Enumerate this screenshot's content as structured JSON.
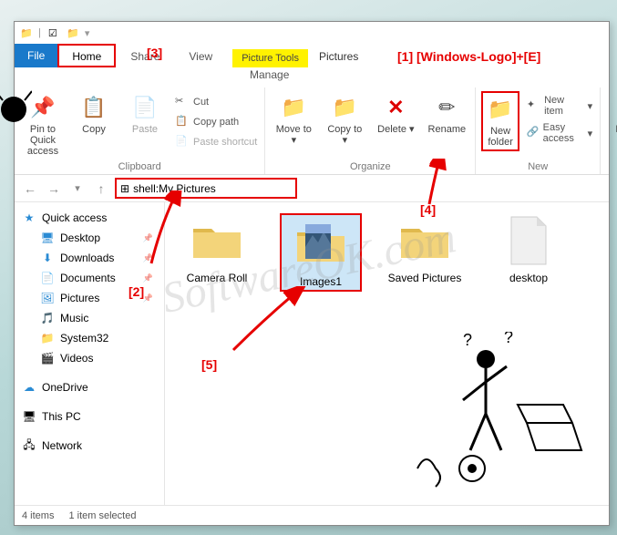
{
  "annotations": {
    "a1": "[1]  [Windows-Logo]+[E]",
    "a2": "[2]",
    "a3": "[3]",
    "a4": "[4]",
    "a5": "[5]"
  },
  "tabs": {
    "file": "File",
    "home": "Home",
    "share": "Share",
    "view": "View",
    "context_tool": "Picture Tools",
    "manage": "Manage",
    "context_label": "Pictures"
  },
  "ribbon": {
    "pin": "Pin to Quick access",
    "copy": "Copy",
    "paste": "Paste",
    "cut": "Cut",
    "copypath": "Copy path",
    "pasteshort": "Paste shortcut",
    "group_clipboard": "Clipboard",
    "moveto": "Move to",
    "copyto": "Copy to",
    "delete": "Delete",
    "rename": "Rename",
    "group_organize": "Organize",
    "newfolder": "New folder",
    "newitem": "New item",
    "easyaccess": "Easy access",
    "group_new": "New",
    "prope": "Prope"
  },
  "address": "shell:My Pictures",
  "nav": {
    "quick": "Quick access",
    "desktop": "Desktop",
    "downloads": "Downloads",
    "documents": "Documents",
    "pictures": "Pictures",
    "music": "Music",
    "system32": "System32",
    "videos": "Videos",
    "onedrive": "OneDrive",
    "thispc": "This PC",
    "network": "Network"
  },
  "items": {
    "i1": "Camera Roll",
    "i2": "Images1",
    "i3": "Saved Pictures",
    "i4": "desktop"
  },
  "status": {
    "count": "4 items",
    "selected": "1 item selected"
  },
  "watermark": "SoftwareOK.com"
}
